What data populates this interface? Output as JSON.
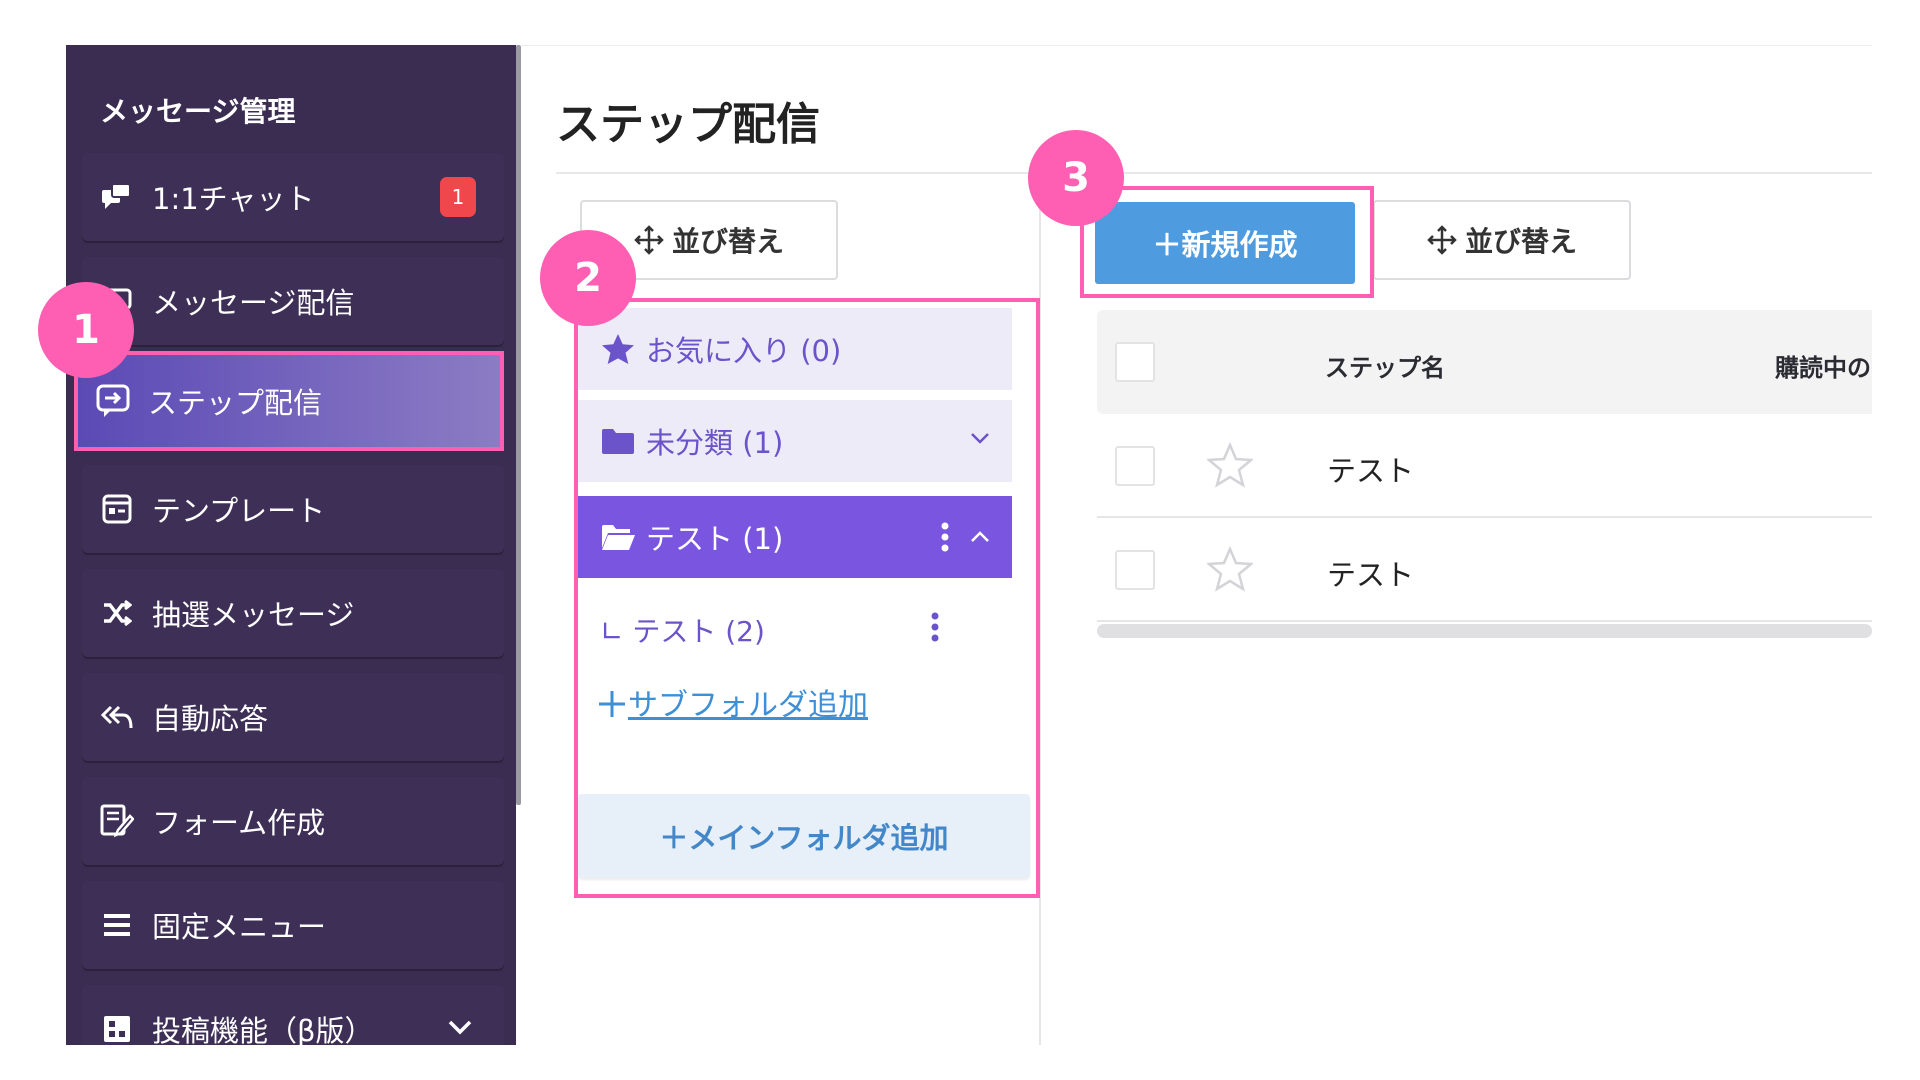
{
  "sidebar": {
    "title": "メッセージ管理",
    "items": [
      {
        "label": "1:1チャット",
        "badge": "1"
      },
      {
        "label": "メッセージ配信"
      },
      {
        "label": "ステップ配信"
      },
      {
        "label": "テンプレート"
      },
      {
        "label": "抽選メッセージ"
      },
      {
        "label": "自動応答"
      },
      {
        "label": "フォーム作成"
      },
      {
        "label": "固定メニュー"
      },
      {
        "label": "投稿機能（β版）"
      }
    ]
  },
  "page": {
    "title": "ステップ配信"
  },
  "folders": {
    "sort_label": "並び替え",
    "favorites": "お気に入り (0)",
    "uncategorized": "未分類 (1)",
    "test": "テスト (1)",
    "subfolder": "∟ テスト (2)",
    "add_subfolder": "サブフォルダ追加",
    "add_main_folder": "＋メインフォルダ追加"
  },
  "toolbar": {
    "create_label": "＋新規作成",
    "sort_label": "並び替え"
  },
  "table": {
    "headers": [
      "ステップ名",
      "購読中の"
    ],
    "rows": [
      {
        "name": "テスト"
      },
      {
        "name": "テスト"
      }
    ]
  },
  "annotations": {
    "markers": [
      "1",
      "2",
      "3"
    ],
    "color": "#ff5fb2"
  },
  "colors": {
    "sidebar_bg": "#3b2c52",
    "accent_purple": "#7a56e0",
    "create_blue": "#4f9be0",
    "badge_red": "#f0474c"
  }
}
